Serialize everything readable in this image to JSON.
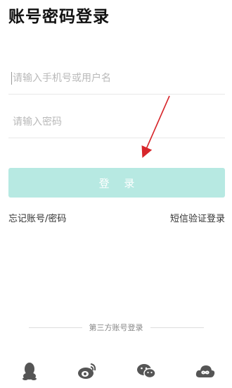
{
  "page": {
    "title": "账号密码登录"
  },
  "form": {
    "phone_placeholder": "请输入手机号或用户名",
    "password_placeholder": "请输入密码",
    "login_label": "登 录"
  },
  "links": {
    "forgot": "忘记账号/密码",
    "sms_login": "短信验证登录"
  },
  "third_party": {
    "label": "第三方账号登录",
    "icons": [
      "qq-icon",
      "weibo-icon",
      "wechat-icon",
      "cloud-icon"
    ]
  },
  "colors": {
    "accent": "#b7e9e2",
    "annotation_arrow": "#d7262b",
    "icon_gray": "#555555"
  }
}
